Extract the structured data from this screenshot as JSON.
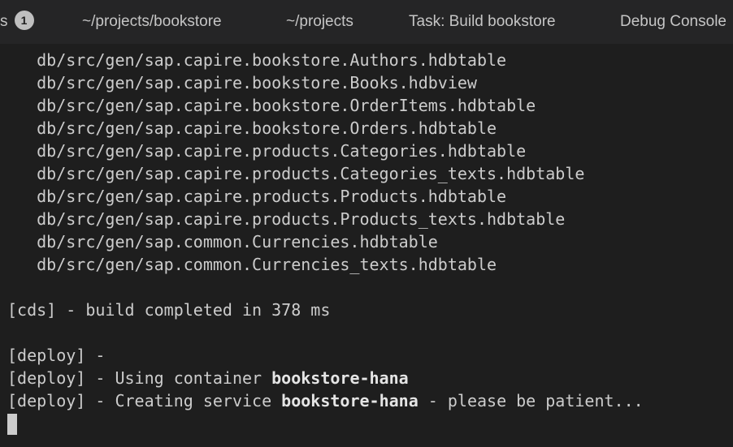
{
  "tabs": [
    {
      "label": "s",
      "badge": "1"
    },
    {
      "label": "~/projects/bookstore"
    },
    {
      "label": "~/projects"
    },
    {
      "label": "Task: Build bookstore"
    },
    {
      "label": "Debug Console"
    }
  ],
  "terminal": {
    "lines": [
      "   db/src/gen/sap.capire.bookstore.Authors.hdbtable",
      "   db/src/gen/sap.capire.bookstore.Books.hdbview",
      "   db/src/gen/sap.capire.bookstore.OrderItems.hdbtable",
      "   db/src/gen/sap.capire.bookstore.Orders.hdbtable",
      "   db/src/gen/sap.capire.products.Categories.hdbtable",
      "   db/src/gen/sap.capire.products.Categories_texts.hdbtable",
      "   db/src/gen/sap.capire.products.Products.hdbtable",
      "   db/src/gen/sap.capire.products.Products_texts.hdbtable",
      "   db/src/gen/sap.common.Currencies.hdbtable",
      "   db/src/gen/sap.common.Currencies_texts.hdbtable",
      "",
      "[cds] - build completed in 378 ms",
      "",
      "[deploy] -"
    ],
    "deploy_using": {
      "prefix": "[deploy] - Using container ",
      "container": "bookstore-hana"
    },
    "deploy_creating": {
      "prefix": "[deploy] - Creating service ",
      "service": "bookstore-hana",
      "suffix": " - please be patient..."
    }
  }
}
